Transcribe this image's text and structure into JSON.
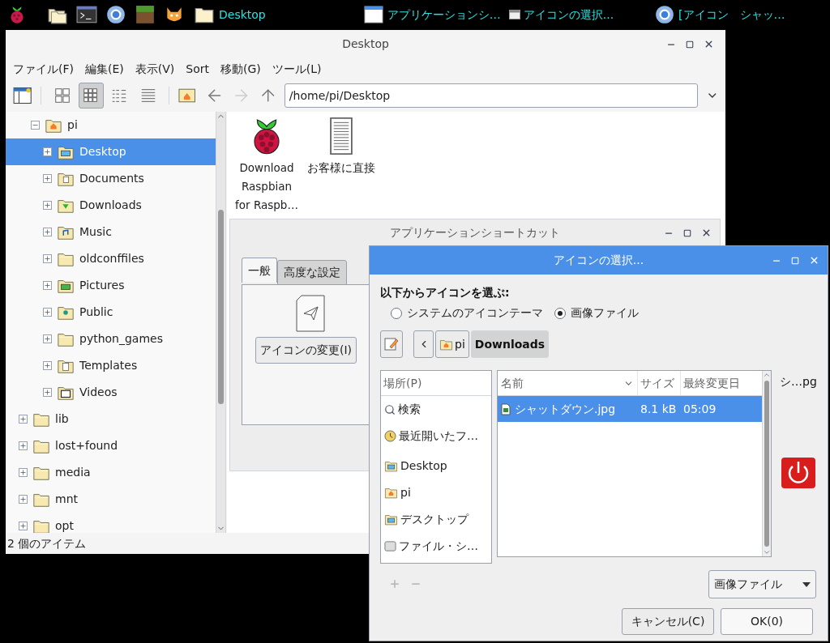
{
  "taskbar": {
    "tasks": [
      {
        "label": "Desktop",
        "kind": "folder"
      },
      {
        "label": "アプリケーションシ…",
        "kind": "window"
      },
      {
        "label": "アイコンの選択...",
        "kind": "dialog"
      },
      {
        "label": "[アイコン　シャッ…",
        "kind": "browser"
      }
    ]
  },
  "file_manager": {
    "title": "Desktop",
    "menu": [
      "ファイル(F)",
      "編集(E)",
      "表示(V)",
      "Sort",
      "移動(G)",
      "ツール(L)"
    ],
    "view_buttons": [
      {
        "kind": "icons",
        "selected": false
      },
      {
        "kind": "thumbnails",
        "selected": true
      },
      {
        "kind": "compact",
        "selected": false
      },
      {
        "kind": "list",
        "selected": false
      }
    ],
    "path": "/home/pi/Desktop",
    "tree": {
      "home_branch": [
        {
          "label": "pi",
          "kind": "home",
          "expanded": true,
          "selected": false,
          "children": [
            {
              "label": "Desktop",
              "kind": "desktop",
              "expanded": false,
              "selected": true
            },
            {
              "label": "Documents",
              "kind": "documents",
              "expanded": false,
              "selected": false
            },
            {
              "label": "Downloads",
              "kind": "downloads",
              "expanded": false,
              "selected": false
            },
            {
              "label": "Music",
              "kind": "music",
              "expanded": false,
              "selected": false
            },
            {
              "label": "oldconffiles",
              "kind": "plain",
              "expanded": false,
              "selected": false
            },
            {
              "label": "Pictures",
              "kind": "pictures",
              "expanded": false,
              "selected": false
            },
            {
              "label": "Public",
              "kind": "public",
              "expanded": false,
              "selected": false
            },
            {
              "label": "python_games",
              "kind": "plain",
              "expanded": false,
              "selected": false
            },
            {
              "label": "Templates",
              "kind": "templates",
              "expanded": false,
              "selected": false
            },
            {
              "label": "Videos",
              "kind": "videos",
              "expanded": false,
              "selected": false
            }
          ]
        }
      ],
      "root_items": [
        {
          "label": "lib",
          "kind": "plain",
          "expanded": false,
          "selected": false
        },
        {
          "label": "lost+found",
          "kind": "plain",
          "expanded": false,
          "selected": false
        },
        {
          "label": "media",
          "kind": "plain",
          "expanded": false,
          "selected": false
        },
        {
          "label": "mnt",
          "kind": "plain",
          "expanded": false,
          "selected": false
        },
        {
          "label": "opt",
          "kind": "plain",
          "expanded": false,
          "selected": false
        }
      ]
    },
    "files": [
      {
        "label": "Download Raspbian for Raspb…",
        "kind": "raspberry"
      },
      {
        "label": "お客様に直接",
        "kind": "document"
      }
    ],
    "status": "2 個のアイテム"
  },
  "shortcut_window": {
    "title": "アプリケーションショートカット",
    "tabs": [
      {
        "label": "一般",
        "selected": true
      },
      {
        "label": "高度な設定",
        "selected": false
      }
    ],
    "change_icon_button": "アイコンの変更(I)"
  },
  "icon_dialog": {
    "title": "アイコンの選択...",
    "heading": "以下からアイコンを選ぶ:",
    "sources": [
      {
        "label": "システムのアイコンテーマ",
        "selected": false
      },
      {
        "label": "画像ファイル",
        "selected": true
      }
    ],
    "path_segments": [
      {
        "label": "pi",
        "kind": "home",
        "selected": false
      },
      {
        "label": "Downloads",
        "kind": "folder",
        "selected": true
      }
    ],
    "places_header": "場所(P)",
    "places": [
      {
        "label": "検索",
        "kind": "search"
      },
      {
        "label": "最近開いたフ…",
        "kind": "recent"
      },
      {
        "label": "Desktop",
        "kind": "desktop"
      },
      {
        "label": "pi",
        "kind": "home"
      },
      {
        "label": "デスクトップ",
        "kind": "desktop"
      },
      {
        "label": "ファイル・シ…",
        "kind": "drive"
      }
    ],
    "columns": [
      "名前",
      "サイズ",
      "最終変更日"
    ],
    "rows": [
      {
        "name": "シャットダウン.jpg",
        "size": "8.1 kB",
        "modified": "05:09",
        "selected": true
      }
    ],
    "preview_name": "シ…pg",
    "filter": "画像ファイル",
    "buttons": [
      "キャンセル(C)",
      "OK(0)"
    ]
  }
}
